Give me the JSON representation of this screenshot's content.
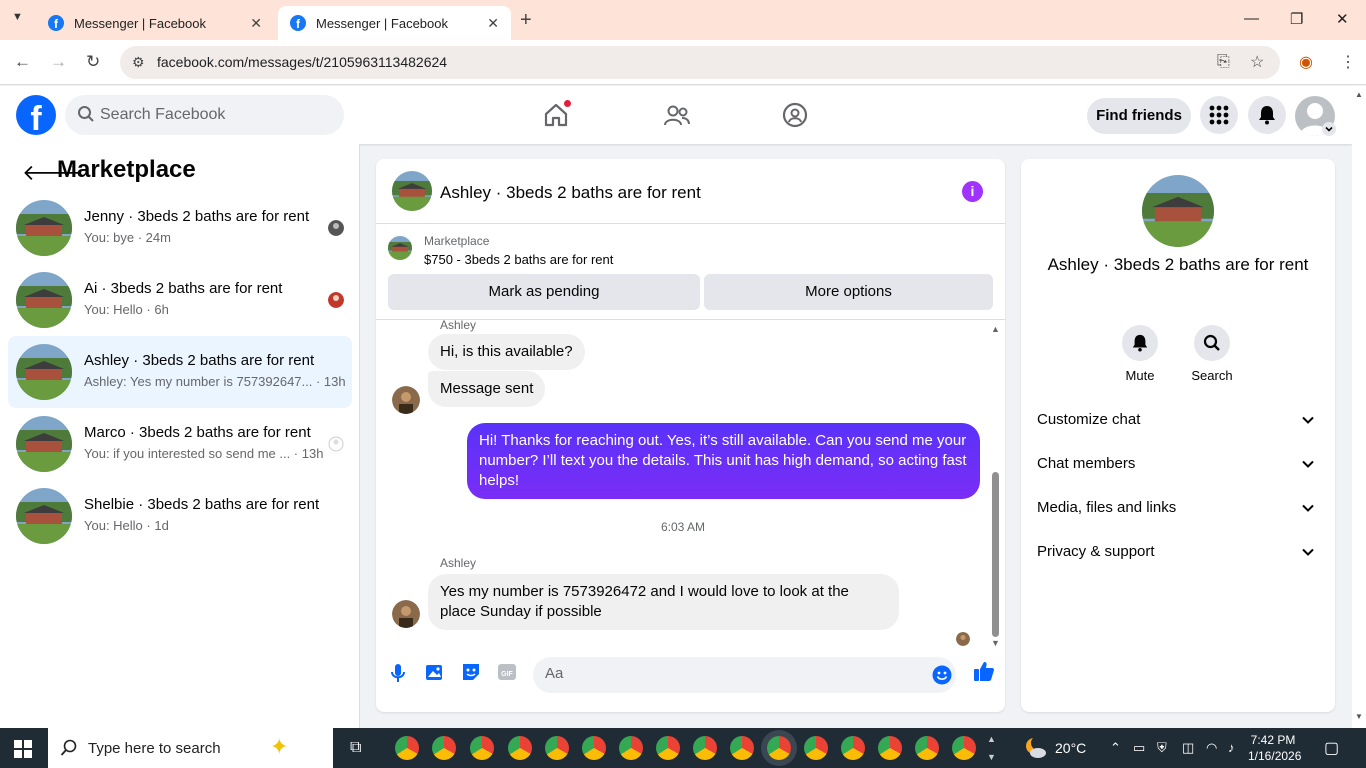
{
  "browser": {
    "tabs": [
      {
        "title": "Messenger | Facebook",
        "active": false
      },
      {
        "title": "Messenger | Facebook",
        "active": true
      }
    ],
    "url": "facebook.com/messages/t/2105963113482624"
  },
  "header": {
    "search_placeholder": "Search Facebook",
    "find_friends": "Find friends"
  },
  "left": {
    "title": "Marketplace",
    "conversations": [
      {
        "name": "Jenny · 3beds 2 baths are for rent",
        "preview": "You: bye · 24m",
        "selected": false
      },
      {
        "name": "Ai · 3beds 2 baths are for rent",
        "preview": "You: Hello · 6h",
        "selected": false
      },
      {
        "name": "Ashley · 3beds 2 baths are for rent",
        "preview": "Ashley: Yes my number is 757392647... · 13h",
        "selected": true
      },
      {
        "name": "Marco · 3beds 2 baths are for rent",
        "preview": "You: if you interested so send me ... · 13h",
        "selected": false
      },
      {
        "name": "Shelbie · 3beds 2 baths are for rent",
        "preview": "You: Hello · 1d",
        "selected": false
      }
    ]
  },
  "chat": {
    "title": "Ashley · 3beds 2 baths are for rent",
    "marketplace_label": "Marketplace",
    "listing": "$750 - 3beds 2 baths are for rent",
    "mark_pending": "Mark as pending",
    "more_options": "More options",
    "sender_name": "Ashley",
    "messages": {
      "in1": "Hi, is this available?",
      "in2": "Message sent",
      "out1": "Hi! Thanks for reaching out. Yes, it’s still available. Can you send me your number? I’ll text you the details. This unit has high demand, so acting fast helps!",
      "timestamp": "6:03 AM",
      "in3": "Yes my number is 7573926472 and I would love to look at the place Sunday if possible"
    },
    "composer_placeholder": "Aa"
  },
  "right": {
    "name": "Ashley · 3beds 2 baths are for rent",
    "mute": "Mute",
    "search": "Search",
    "sections": [
      "Customize chat",
      "Chat members",
      "Media, files and links",
      "Privacy & support"
    ]
  },
  "taskbar": {
    "search_placeholder": "Type here to search",
    "weather": "20°C",
    "time": "7:42 PM",
    "date": "1/16/2026"
  },
  "colors": {
    "fb_blue": "#0866ff",
    "outgoing_bubble": "#6b2cf5",
    "selected_row": "#ebf5ff"
  }
}
